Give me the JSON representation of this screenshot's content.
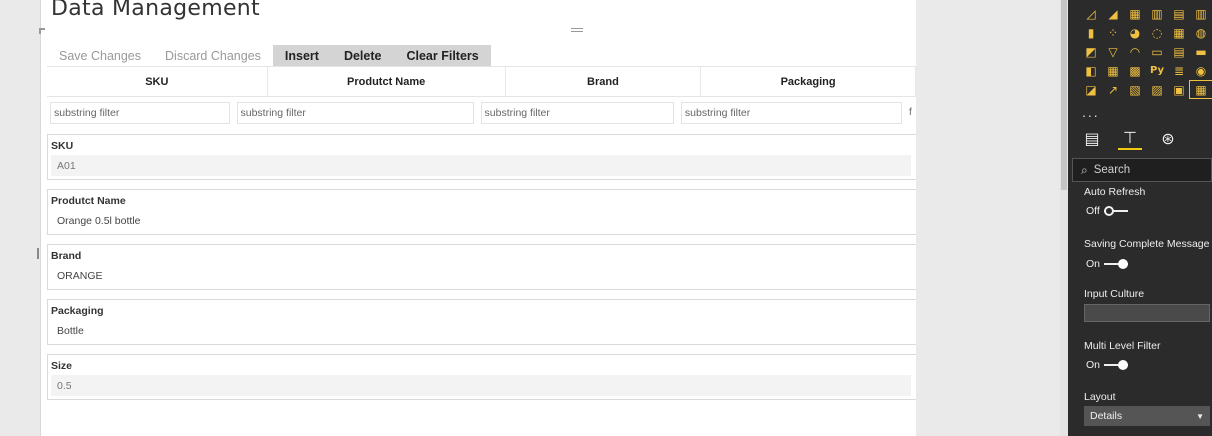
{
  "report": {
    "title": "Data Management"
  },
  "toolbar": {
    "save_label": "Save Changes",
    "discard_label": "Discard Changes",
    "insert_label": "Insert",
    "delete_label": "Delete",
    "clear_filters_label": "Clear Filters"
  },
  "grid": {
    "columns": [
      "SKU",
      "Produtct Name",
      "Brand",
      "Packaging"
    ],
    "filter_placeholder": "substring filter",
    "partial_filter_text": "f"
  },
  "details": [
    {
      "label": "SKU",
      "value": "A01"
    },
    {
      "label": "Produtct Name",
      "value": "Orange 0.5l bottle"
    },
    {
      "label": "Brand",
      "value": "ORANGE"
    },
    {
      "label": "Packaging",
      "value": "Bottle"
    },
    {
      "label": "Size",
      "value": "0.5"
    }
  ],
  "format_panel": {
    "more_label": "...",
    "search_placeholder": "Search",
    "auto_refresh": {
      "label": "Auto Refresh",
      "state": "Off"
    },
    "saving_complete": {
      "label": "Saving Complete Message",
      "state": "On"
    },
    "input_culture": {
      "label": "Input Culture",
      "value": ""
    },
    "multi_level_filter": {
      "label": "Multi Level Filter",
      "state": "On"
    },
    "layout": {
      "label": "Layout",
      "value": "Details"
    }
  },
  "colors": {
    "panel_bg": "#2b2b2b",
    "accent": "#f2c811",
    "active_button": "#d4d4d4"
  }
}
